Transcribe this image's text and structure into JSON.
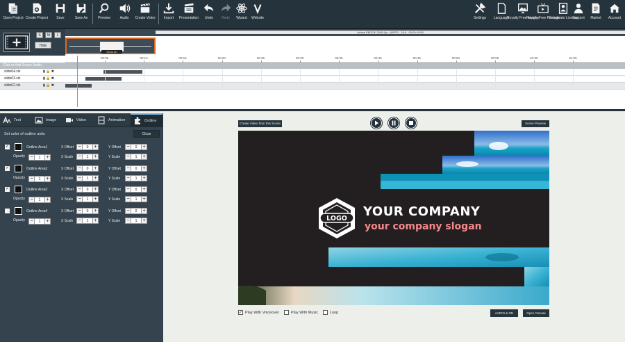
{
  "toolbar": {
    "left": [
      {
        "label": "Open Project",
        "icon": "folder-open-icon"
      },
      {
        "label": "Create Project",
        "icon": "new-project-icon"
      },
      {
        "label": "Save",
        "icon": "save-icon"
      },
      {
        "label": "Save As",
        "icon": "save-as-icon"
      },
      {
        "label": "Preview",
        "icon": "magnifier-icon"
      },
      {
        "label": "Audio",
        "icon": "speaker-icon"
      },
      {
        "label": "Create Video",
        "icon": "clapperboard-icon"
      },
      {
        "label": "Import",
        "icon": "import-icon"
      },
      {
        "label": "Presentation",
        "icon": "presentation-icon"
      },
      {
        "label": "Undo",
        "icon": "undo-icon"
      },
      {
        "label": "Redo",
        "icon": "redo-icon"
      },
      {
        "label": "Wizard",
        "icon": "wizard-icon"
      },
      {
        "label": "Website",
        "icon": "website-v-icon"
      }
    ],
    "right": [
      {
        "label": "Settings",
        "icon": "tools-icon"
      },
      {
        "label": "Language",
        "icon": "language-icon"
      },
      {
        "label": "Royalty Free Images",
        "icon": "image-icon"
      },
      {
        "label": "Royalty Free Footage",
        "icon": "tv-icon"
      },
      {
        "label": "Deactivate License",
        "icon": "license-icon"
      },
      {
        "label": "Support",
        "icon": "support-icon"
      },
      {
        "label": "Market",
        "icon": "market-icon"
      },
      {
        "label": "Account",
        "icon": "home-icon"
      }
    ]
  },
  "timeline": {
    "scene_buttons": [
      "S",
      "M",
      "L"
    ],
    "hide_label": "Hide",
    "status_text": "Adobe EBOOK 2000 9pt - 60FPS - 16:9 - 00:00:19:59",
    "current_time": "00:11.00",
    "ticks": [
      "00:05",
      "00:10",
      "00:15",
      "00:20",
      "00:25",
      "00:30",
      "00:35",
      "00:40",
      "00:45",
      "00:50",
      "00:55",
      "01:00",
      "01:05"
    ],
    "add_scene_audio": "Click to Add Scene Audio...",
    "tracks": [
      {
        "name": "slide04.xls",
        "bar_start": 4.9,
        "bar_end": 9.9
      },
      {
        "name": "slide03.xls",
        "bar_start": 2.6,
        "bar_end": 7.2
      },
      {
        "name": "slide02.xls",
        "bar_start": 0.0,
        "bar_end": 3.4
      }
    ]
  },
  "panel": {
    "tabs": [
      {
        "label": "Text",
        "icon": "text-icon"
      },
      {
        "label": "Image",
        "icon": "image-tab-icon"
      },
      {
        "label": "Video",
        "icon": "video-tab-icon"
      },
      {
        "label": "Animation",
        "icon": "animation-icon"
      },
      {
        "label": "Outline",
        "icon": "puzzle-icon"
      }
    ],
    "set_color_label": "Set color of outline units",
    "close_label": "Close",
    "x_offset_label": "X Offset",
    "y_offset_label": "Y Offset",
    "x_scale_label": "X Scale",
    "y_scale_label": "Y Scale",
    "opacity_label": "Opacity",
    "areas": [
      {
        "name": "Outline Area1",
        "checked": true,
        "opacity": "1",
        "x_offset": "0",
        "y_offset": "0",
        "x_scale": "1",
        "y_scale": "1"
      },
      {
        "name": "Outline Area2",
        "checked": true,
        "opacity": "1",
        "x_offset": "0",
        "y_offset": "0",
        "x_scale": "1",
        "y_scale": "1"
      },
      {
        "name": "Outline Area3",
        "checked": true,
        "opacity": "1",
        "x_offset": "0",
        "y_offset": "0",
        "x_scale": "1",
        "y_scale": "1"
      },
      {
        "name": "Outline Area4",
        "checked": false,
        "opacity": "1",
        "x_offset": "0",
        "y_offset": "0",
        "x_scale": "1",
        "y_scale": "1"
      }
    ]
  },
  "preview": {
    "create_video_label": "Create Video from this Scene",
    "scene_preview_label": "Scene Preview",
    "logo_text": "LOGO",
    "brand_name": "YOUR COMPANY",
    "brand_slogan": "your company slogan",
    "options": [
      {
        "label": "Play With Voiceover",
        "checked": true
      },
      {
        "label": "Play With Music",
        "checked": false
      },
      {
        "label": "Loop",
        "checked": false
      }
    ],
    "audio_btn_label": "AUDIO & ON",
    "open_canvas_label": "Open Canvas"
  },
  "colors": {
    "toolbar_bg": "#25333c",
    "panel_bg": "#34434d",
    "canvas_bg": "#231f20",
    "slogan": "#f4898c",
    "playhead": "#e07b3c"
  }
}
